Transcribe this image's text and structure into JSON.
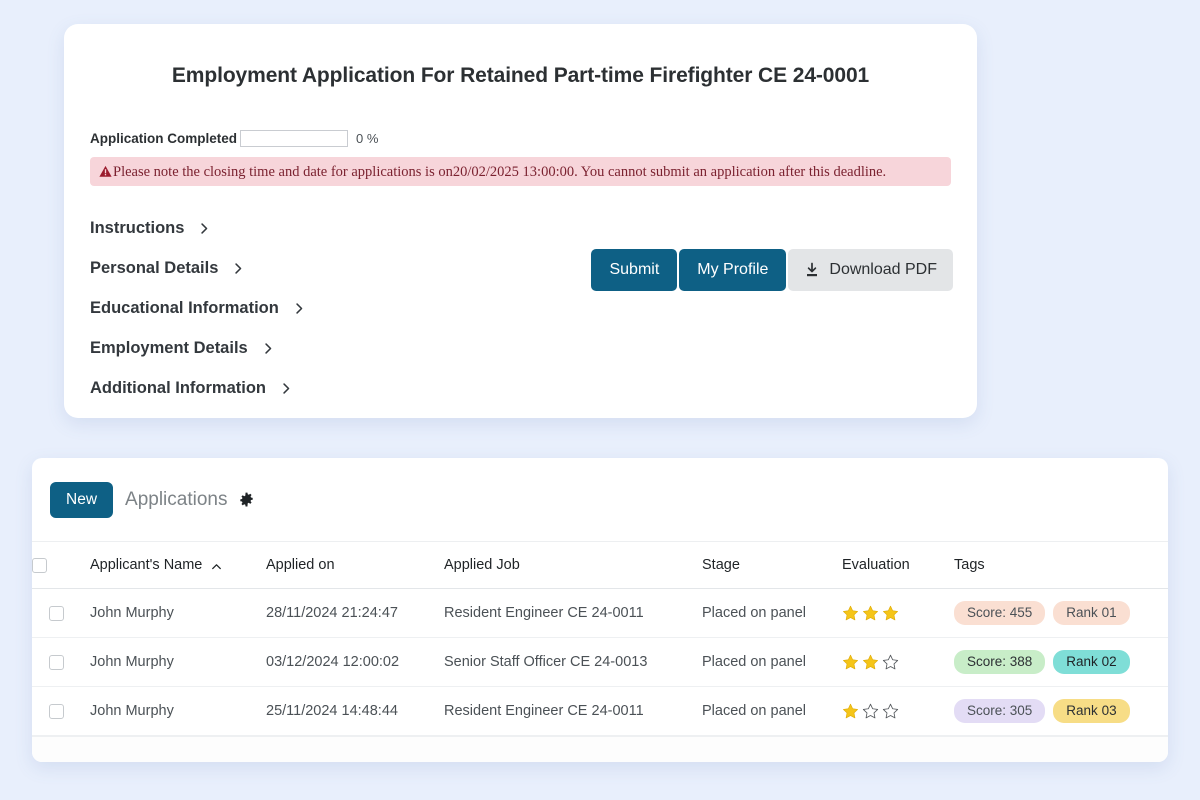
{
  "theme": {
    "page_background": "#e8effc",
    "card_background": "#ffffff",
    "primary": "#0e6085",
    "alert_background": "#f7d5da",
    "alert_text": "#7b2230",
    "star_filled": "#f5c518",
    "star_empty": "#ffffff"
  },
  "application": {
    "title": "Employment Application For Retained Part-time Firefighter CE 24-0001",
    "progress": {
      "label": "Application Completed",
      "percent_text": "0 %",
      "percent_value": 0
    },
    "alert": {
      "icon": "warning-triangle-icon",
      "text": "Please note the closing time and date for applications is on20/02/2025 13:00:00. You cannot submit an application after this deadline."
    },
    "sections": [
      {
        "label": "Instructions",
        "icon": "chevron-right-icon"
      },
      {
        "label": "Personal Details",
        "icon": "chevron-right-icon"
      },
      {
        "label": "Educational Information",
        "icon": "chevron-right-icon"
      },
      {
        "label": "Employment Details",
        "icon": "chevron-right-icon"
      },
      {
        "label": "Additional Information",
        "icon": "chevron-right-icon"
      }
    ],
    "buttons": {
      "submit": "Submit",
      "my_profile": "My Profile",
      "download_pdf": "Download PDF",
      "download_icon": "download-icon"
    }
  },
  "applications_panel": {
    "new_button": "New",
    "title": "Applications",
    "settings_icon": "gear-icon",
    "columns": [
      {
        "label": "Applicant's Name",
        "sorted": true,
        "sort_icon": "chevron-up-icon"
      },
      {
        "label": "Applied on",
        "sorted": false
      },
      {
        "label": "Applied Job",
        "sorted": false
      },
      {
        "label": "Stage",
        "sorted": false
      },
      {
        "label": "Evaluation",
        "sorted": false
      },
      {
        "label": "Tags",
        "sorted": false
      }
    ],
    "rows": [
      {
        "name": "John Murphy",
        "applied_on": "28/11/2024 21:24:47",
        "applied_job": "Resident Engineer CE 24-0011",
        "stage": "Placed on panel",
        "stars_filled": 3,
        "stars_total": 3,
        "tags": [
          {
            "text": "Score: 455",
            "bg": "#fadfd2",
            "fg": "#4b5156"
          },
          {
            "text": "Rank 01",
            "bg": "#fadfd2",
            "fg": "#4b5156"
          }
        ]
      },
      {
        "name": "John Murphy",
        "applied_on": "03/12/2024 12:00:02",
        "applied_job": "Senior Staff Officer CE 24-0013",
        "stage": "Placed on panel",
        "stars_filled": 2,
        "stars_total": 3,
        "tags": [
          {
            "text": "Score: 388",
            "bg": "#c8edc8",
            "fg": "#2c3033"
          },
          {
            "text": "Rank 02",
            "bg": "#7fded7",
            "fg": "#1f2326"
          }
        ]
      },
      {
        "name": "John Murphy",
        "applied_on": "25/11/2024 14:48:44",
        "applied_job": "Resident Engineer CE 24-0011",
        "stage": "Placed on panel",
        "stars_filled": 1,
        "stars_total": 3,
        "tags": [
          {
            "text": "Score: 305",
            "bg": "#e3dcf5",
            "fg": "#4b5156"
          },
          {
            "text": "Rank 03",
            "bg": "#f7dd86",
            "fg": "#2c3033"
          }
        ]
      }
    ]
  }
}
